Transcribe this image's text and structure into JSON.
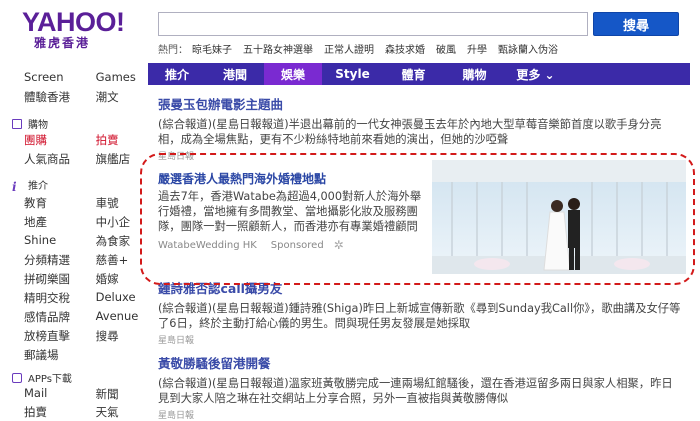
{
  "header": {
    "logo_main": "YAHOO!",
    "logo_sub": "雅虎香港",
    "search_placeholder": "",
    "search_button": "搜尋",
    "hot_label": "熱門：",
    "hot_items": [
      "晾毛妹子",
      "五十路女神選舉",
      "正常人證明",
      "森技求婚",
      "破風",
      "升學",
      "甄詠蘭入伪浴"
    ]
  },
  "nav": {
    "items": [
      "推介",
      "港聞",
      "娛樂",
      "Style",
      "體育",
      "購物",
      "更多 ⌄"
    ],
    "active_index": 2
  },
  "sidebar": {
    "rows_top": [
      {
        "c1": "Screen",
        "c2": "Games"
      },
      {
        "c1": "體驗香港",
        "c2": "潮文"
      }
    ],
    "shop_head": "購物",
    "shop_rows": [
      {
        "c1": "團購",
        "c2": "拍賣"
      },
      {
        "c1": "人氣商品",
        "c2": "旗艦店"
      }
    ],
    "rec_head": "推介",
    "rec_rows": [
      {
        "c1": "教育",
        "c2": "車號"
      },
      {
        "c1": "地產",
        "c2": "中小企"
      },
      {
        "c1": "Shine",
        "c2": "為食家"
      },
      {
        "c1": "分頻精選",
        "c2": "慈善+"
      },
      {
        "c1": "拼砌樂園",
        "c2": "婚嫁"
      },
      {
        "c1": "精明交稅",
        "c2": "Deluxe"
      },
      {
        "c1": "感情品牌",
        "c2": "Avenue"
      },
      {
        "c1": "放榜直擊",
        "c2": "搜尋"
      },
      {
        "c1": "郵議場",
        "c2": ""
      }
    ],
    "apps_head": "APPs下載",
    "apps_rows": [
      {
        "c1": "Mail",
        "c2": "新聞"
      },
      {
        "c1": "拍賣",
        "c2": "天氣"
      }
    ]
  },
  "stories": [
    {
      "title": "張曼玉包辦電影主題曲",
      "body": "(綜合報道)(星島日報報道)半退出幕前的一代女神張曼玉去年於內地大型草莓音樂節首度以歌手身分亮相，成為全場焦點，更有不少粉絲特地前來看她的演出，但她的沙啞聲",
      "source": "星島日報"
    },
    {
      "title": "鍾詩雅否認call攝男友",
      "body": "(綜合報道)(星島日報報道)鍾詩雅(Shiga)昨日上新城宣傳新歌《尋到Sunday我Call你》，歌曲講及女仔等了6日，終於主動打給心儀的男生。問與現任男友發展是她採取",
      "source": "星島日報"
    },
    {
      "title": "黃敬勝騷後留港開餐",
      "body": "(綜合報道)(星島日報報道)溫家班黃敬勝完成一連兩場紅館騷後，還在香港逗留多兩日與家人相聚，昨日見到大家人陪之琳在社交網站上分享合照，另外一直被指與黃敬勝傳似",
      "source": "星島日報"
    }
  ],
  "ad": {
    "title": "嚴選香港人最熱門海外婚禮地點",
    "body": "過去7年，香港Watabe為超過4,000對新人於海外舉行婚禮，當地擁有多間教堂、當地攝影化妝及服務團隊，團隊一對一照顧新人，而香港亦有專業婚禮顧問",
    "advertiser": "WatabeWedding HK",
    "sponsored": "Sponsored"
  },
  "colors": {
    "brand": "#5a1f98",
    "nav_bg": "#3b2aa8",
    "nav_active": "#7a2ad1",
    "search_button": "#1557c7",
    "highlight_border": "#d31a1a"
  }
}
